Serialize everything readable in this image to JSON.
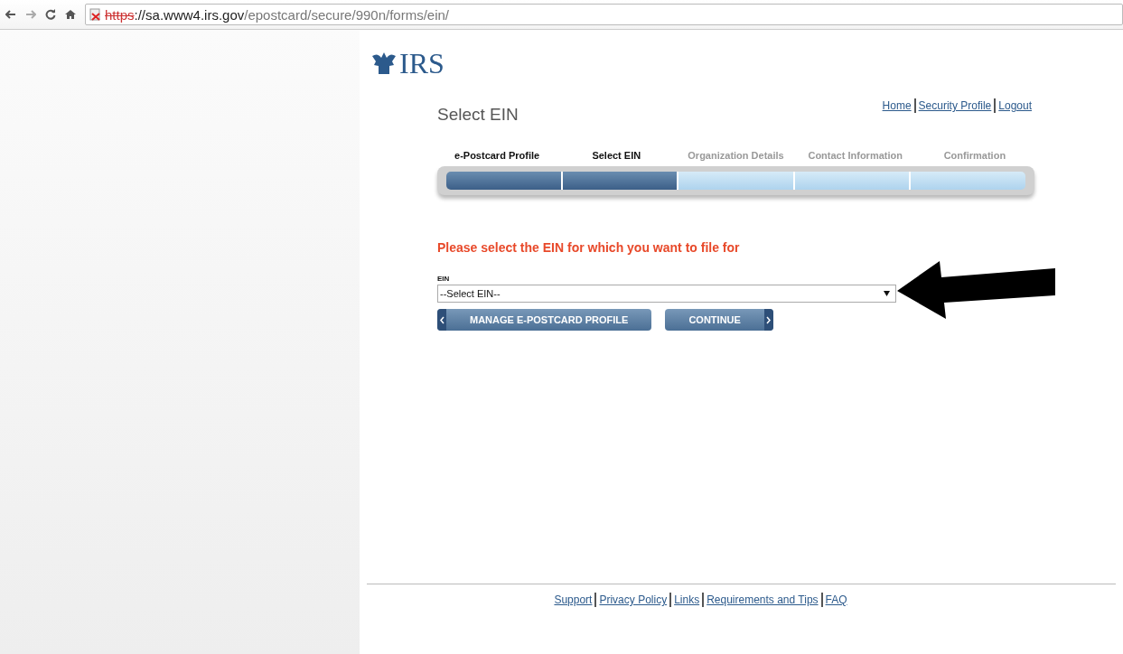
{
  "browser": {
    "url_scheme": "https",
    "url_host": "://sa.www4.irs.gov",
    "url_path": "/epostcard/secure/990n/forms/ein/",
    "insecure": true
  },
  "logo": {
    "text": "IRS"
  },
  "page_title": "Select EIN",
  "top_links": [
    "Home",
    "Security Profile",
    "Logout"
  ],
  "steps": [
    {
      "label": "e-Postcard Profile",
      "completed": true
    },
    {
      "label": "Select EIN",
      "completed": true
    },
    {
      "label": "Organization Details",
      "completed": false
    },
    {
      "label": "Contact Information",
      "completed": false
    },
    {
      "label": "Confirmation",
      "completed": false
    }
  ],
  "prompt": "Please select the EIN for which you want to file for",
  "ein_field": {
    "label": "EIN",
    "value": "--Select EIN--"
  },
  "buttons": [
    {
      "label": "MANAGE E-POSTCARD PROFILE",
      "kind": "back"
    },
    {
      "label": "CONTINUE",
      "kind": "next"
    }
  ],
  "footer_links": [
    "Support",
    "Privacy Policy",
    "Links",
    "Requirements and Tips",
    "FAQ"
  ]
}
